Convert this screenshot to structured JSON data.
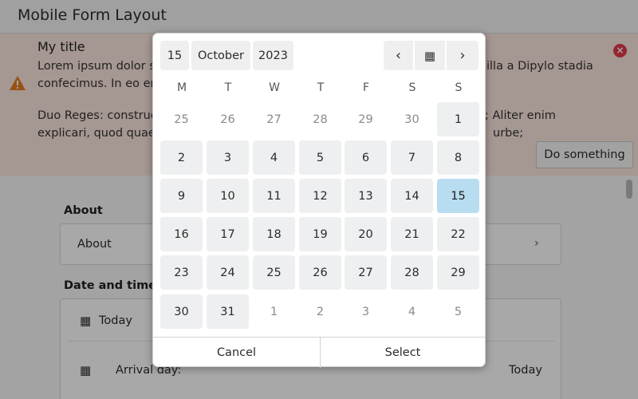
{
  "window": {
    "title": "Mobile Form Layout"
  },
  "banner": {
    "title": "My title",
    "text_line1": "Lorem ipsum dolor s",
    "text_line1_right": "illa a Dipylo stadia",
    "text_line2": "confecimus. In eo er",
    "text_line3": "Duo Reges: construc",
    "text_line3_right": "; Aliter enim",
    "text_line4": "explicari, quod quae",
    "text_line4_right": "urbe;",
    "action_label": "Do something"
  },
  "form": {
    "about_section": "About",
    "about_row": "About",
    "datetime_section": "Date and time",
    "today_row": "Today",
    "arrival_label": "Arrival day:",
    "arrival_value": "Today"
  },
  "picker": {
    "day_value": "15",
    "month_value": "October",
    "year_value": "2023",
    "weekdays": [
      "M",
      "T",
      "W",
      "T",
      "F",
      "S",
      "S"
    ],
    "weeks": [
      [
        {
          "d": "25",
          "t": "other"
        },
        {
          "d": "26",
          "t": "other"
        },
        {
          "d": "27",
          "t": "other"
        },
        {
          "d": "28",
          "t": "other"
        },
        {
          "d": "29",
          "t": "other"
        },
        {
          "d": "30",
          "t": "other"
        },
        {
          "d": "1",
          "t": "cur"
        }
      ],
      [
        {
          "d": "2",
          "t": "cur"
        },
        {
          "d": "3",
          "t": "cur"
        },
        {
          "d": "4",
          "t": "cur"
        },
        {
          "d": "5",
          "t": "cur"
        },
        {
          "d": "6",
          "t": "cur"
        },
        {
          "d": "7",
          "t": "cur"
        },
        {
          "d": "8",
          "t": "cur"
        }
      ],
      [
        {
          "d": "9",
          "t": "cur"
        },
        {
          "d": "10",
          "t": "cur"
        },
        {
          "d": "11",
          "t": "cur"
        },
        {
          "d": "12",
          "t": "cur"
        },
        {
          "d": "13",
          "t": "cur"
        },
        {
          "d": "14",
          "t": "cur"
        },
        {
          "d": "15",
          "t": "sel"
        }
      ],
      [
        {
          "d": "16",
          "t": "cur"
        },
        {
          "d": "17",
          "t": "cur"
        },
        {
          "d": "18",
          "t": "cur"
        },
        {
          "d": "19",
          "t": "cur"
        },
        {
          "d": "20",
          "t": "cur"
        },
        {
          "d": "21",
          "t": "cur"
        },
        {
          "d": "22",
          "t": "cur"
        }
      ],
      [
        {
          "d": "23",
          "t": "cur"
        },
        {
          "d": "24",
          "t": "cur"
        },
        {
          "d": "25",
          "t": "cur"
        },
        {
          "d": "26",
          "t": "cur"
        },
        {
          "d": "27",
          "t": "cur"
        },
        {
          "d": "28",
          "t": "cur"
        },
        {
          "d": "29",
          "t": "cur"
        }
      ],
      [
        {
          "d": "30",
          "t": "cur"
        },
        {
          "d": "31",
          "t": "cur"
        },
        {
          "d": "1",
          "t": "other"
        },
        {
          "d": "2",
          "t": "other"
        },
        {
          "d": "3",
          "t": "other"
        },
        {
          "d": "4",
          "t": "other"
        },
        {
          "d": "5",
          "t": "other"
        }
      ]
    ],
    "cancel_label": "Cancel",
    "select_label": "Select",
    "prev_icon": "chevron-left-icon",
    "next_icon": "chevron-right-icon",
    "today_icon": "calendar-icon",
    "selected_color": "#b8dcf0"
  }
}
